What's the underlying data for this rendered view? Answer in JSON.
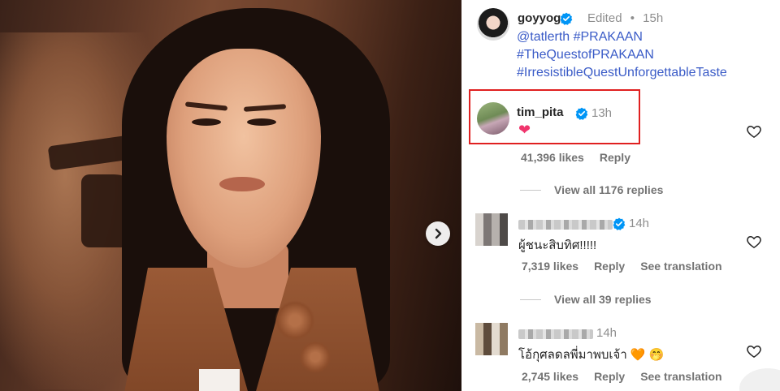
{
  "post": {
    "navigation": {
      "next_icon": "chevron-right-icon"
    }
  },
  "caption": {
    "username": "goyyog",
    "edited_label": "Edited",
    "separator": "•",
    "time": "15h",
    "hashtags": [
      "@tatlerth #PRAKAAN",
      "#TheQuestofPRAKAAN",
      "#IrresistibleQuestUnforgettableTaste"
    ]
  },
  "comments": [
    {
      "username": "tim_pita",
      "verified": true,
      "time": "13h",
      "text": "❤",
      "likes": "41,396 likes",
      "reply_label": "Reply",
      "view_replies": "View all 1176 replies",
      "highlighted": true,
      "highlight_color": "#e02020"
    },
    {
      "username": "",
      "verified": true,
      "time": "14h",
      "text": "ผู้ชนะสิบทิศ!!!!!",
      "likes": "7,319 likes",
      "reply_label": "Reply",
      "translate_label": "See translation",
      "view_replies": "View all 39 replies"
    },
    {
      "username": "",
      "verified": false,
      "time": "14h",
      "text": "โอ้กุศลดลพี่มาพบเจ้า 🧡 🤭",
      "likes": "2,745 likes",
      "reply_label": "Reply",
      "translate_label": "See translation"
    }
  ],
  "colors": {
    "hashtag": "#3a5bc7",
    "verified": "#0095f6",
    "muted": "#8e8e8e"
  }
}
